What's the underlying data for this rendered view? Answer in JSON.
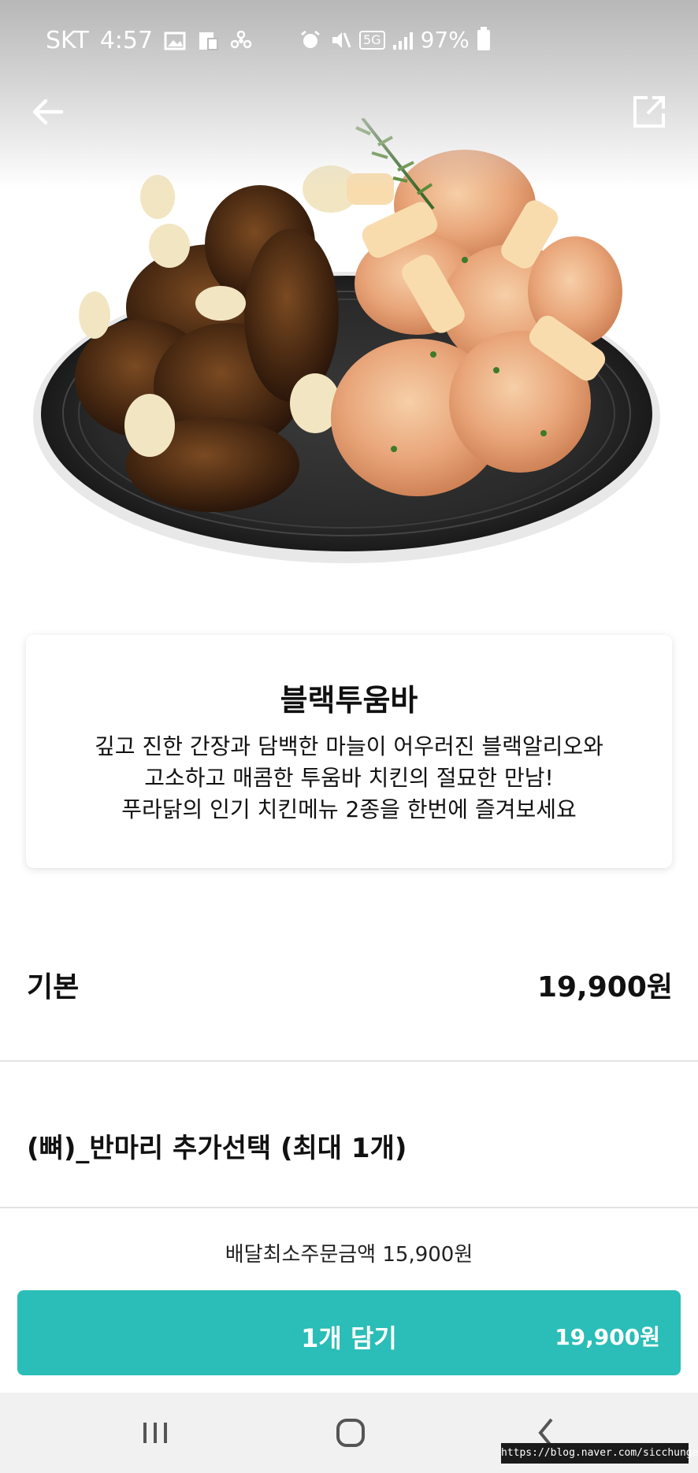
{
  "status_bar": {
    "carrier": "SKT",
    "time": "4:57",
    "network": "5G",
    "battery": "97%"
  },
  "header": {
    "back_icon": "arrow-left-icon",
    "share_icon": "share-external-icon"
  },
  "menu": {
    "title": "블랙투움바",
    "description": [
      "깊고 진한 간장과 담백한 마늘이 어우러진 블랙알리오와",
      "고소하고 매콤한 투움바 치킨의 절묘한 만남!",
      "푸라닭의 인기 치킨메뉴 2종을 한번에 즐겨보세요"
    ]
  },
  "price": {
    "label": "기본",
    "value": "19,900원"
  },
  "option": {
    "label": "(뼈)_반마리 추가선택 (최대 1개)"
  },
  "order": {
    "min_order": "배달최소주문금액 15,900원",
    "cart_label": "1개 담기",
    "cart_price": "19,900원"
  },
  "nav": {
    "recent_icon": "recent-apps-icon",
    "home_icon": "home-icon",
    "back_icon": "back-chevron-icon"
  },
  "watermark": "https://blog.naver.com/sicchungel",
  "colors": {
    "accent": "#2bbdb7",
    "divider": "#e3e3e3"
  }
}
